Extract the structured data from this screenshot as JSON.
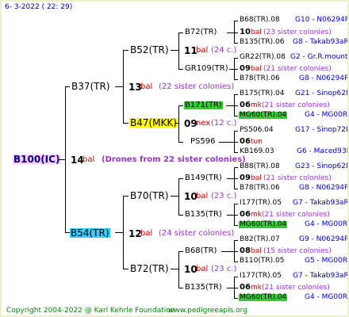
{
  "header": {
    "date": "6-  3-2022 ( 22: 29)"
  },
  "footer": {
    "copyright": "Copyright 2004-2022 @ Karl Kehrle Foundation",
    "site": "www.pedigreeapis.org"
  },
  "root": {
    "name": "B100(IC)",
    "count": "14",
    "bal": "bal",
    "note": "(Drones from 22 sister colonies)"
  },
  "gen1": [
    {
      "name": "B37(TR)",
      "count": "13",
      "bal": "bal",
      "note": "(22 sister colonies)"
    },
    {
      "name": "B54(TR)",
      "count": "12",
      "bal": "bal",
      "note": "(24 sister colonies)"
    }
  ],
  "gen2": [
    {
      "name": "B52(TR)",
      "count": "11",
      "bal": "bal",
      "note": "(24 c.)"
    },
    {
      "name": "B47(MKK)",
      "count": "09",
      "bal": "nex",
      "note": "(12 c.)"
    },
    {
      "name": "B70(TR)",
      "count": "10",
      "bal": "bal",
      "note": "(23 c.)"
    },
    {
      "name": "B72(TR)",
      "count": "10",
      "bal": "bal",
      "note": "(23 c.)"
    }
  ],
  "gen3": [
    {
      "name": "B72(TR)"
    },
    {
      "name": "GR109(TR)"
    },
    {
      "name": "B171(TR)"
    },
    {
      "name": "PS596"
    },
    {
      "name": "B149(TR)"
    },
    {
      "name": "B135(TR)"
    },
    {
      "name": "B68(TR)"
    },
    {
      "name": "B135(TR)"
    }
  ],
  "gen4": [
    {
      "name": "B68(TR).08",
      "id": "G10 - N06294R"
    },
    {
      "count": "10",
      "bal": "bal",
      "note": "(23 sister colonies)"
    },
    {
      "name": "B135(TR).06",
      "id": "G8 - Takab93aR"
    },
    {
      "name": "GR22(TR).08",
      "id": "G2 - Gr.R.mounta"
    },
    {
      "count": "09",
      "bal": "bal",
      "note": "(21 sister colonies)"
    },
    {
      "name": "B78(TR).06",
      "id": "G8 - N06294R"
    },
    {
      "name": "B175(TR).04",
      "id": "G21 - Sinop62R"
    },
    {
      "count": "06",
      "bal": "mk",
      "note": "(21 sister colonies)"
    },
    {
      "name": "MG60(TR).04",
      "id": "G4 - MG00R"
    },
    {
      "name": "PS506.04",
      "id": "G17 - Sinop72R"
    },
    {
      "count": "06",
      "bal": "tun",
      "note": ""
    },
    {
      "name": "KB169.03",
      "id": "G6 - Maced93R"
    },
    {
      "name": "B88(TR).08",
      "id": "G23 - Sinop62R"
    },
    {
      "count": "09",
      "bal": "bal",
      "note": "(21 sister colonies)"
    },
    {
      "name": "B78(TR).06",
      "id": "G8 - N06294R"
    },
    {
      "name": "I177(TR).05",
      "id": "G7 - Takab93aR"
    },
    {
      "count": "06",
      "bal": "mk",
      "note": "(21 sister colonies)"
    },
    {
      "name": "MG60(TR).04",
      "id": "G4 - MG00R"
    },
    {
      "name": "B82(TR).07",
      "id": "G9 - N06294R"
    },
    {
      "count": "08",
      "bal": "bal",
      "note": "(15 sister colonies)"
    },
    {
      "name": "B110(TR).05",
      "id": "G5 - MG00R"
    },
    {
      "name": "I177(TR).05",
      "id": "G7 - Takab93aR"
    },
    {
      "count": "06",
      "bal": "mk",
      "note": "(21 sister colonies)"
    },
    {
      "name": "MG60(TR).04",
      "id": "G4 - MG00R"
    }
  ]
}
